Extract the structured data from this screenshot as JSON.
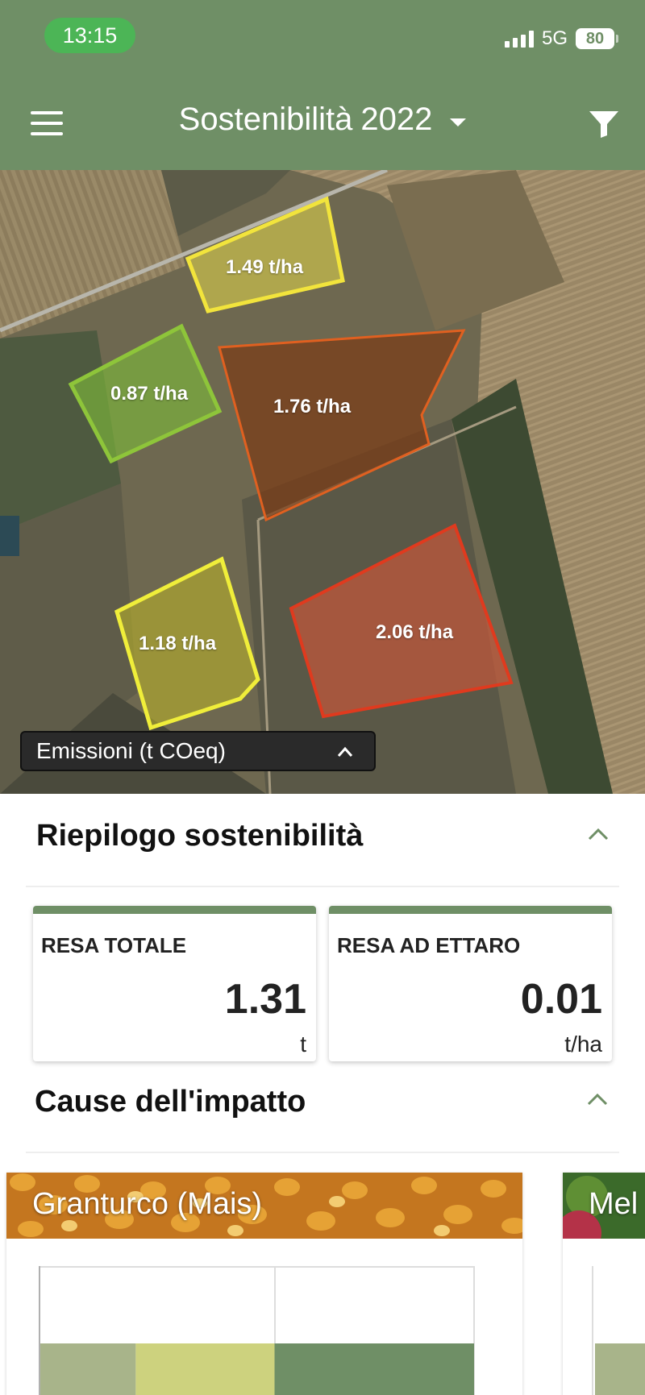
{
  "status_bar": {
    "time": "13:15",
    "network": "5G",
    "battery": "80"
  },
  "header": {
    "title": "Sostenibilità",
    "year": "2022",
    "menu_icon": "hamburger-menu-icon",
    "filter_icon": "filter-icon",
    "dropdown_icon": "caret-down-icon"
  },
  "map": {
    "fields": [
      {
        "label": "1.49 t/ha",
        "color": "#e6d94a"
      },
      {
        "label": "0.87 t/ha",
        "color": "#7cb73a"
      },
      {
        "label": "1.76 t/ha",
        "color": "#e05a1e"
      },
      {
        "label": "1.18 t/ha",
        "color": "#f0ee3a"
      },
      {
        "label": "2.06 t/ha",
        "color": "#e03a1e"
      }
    ],
    "legend_label": "Emissioni (t COeq)"
  },
  "summary": {
    "title": "Riepilogo sostenibilità",
    "cards": [
      {
        "label": "RESA TOTALE",
        "value": "1.31",
        "unit": "t"
      },
      {
        "label": "RESA AD ETTARO",
        "value": "0.01",
        "unit": "t/ha"
      }
    ]
  },
  "impact": {
    "title": "Cause dell'impatto",
    "crops": [
      {
        "name": "Granturco (Mais)",
        "bars": [
          {
            "share": 0.22,
            "color": "#a8b48a"
          },
          {
            "share": 0.32,
            "color": "#cdd27e"
          },
          {
            "share": 0.46,
            "color": "#6f8f66"
          }
        ]
      },
      {
        "name": "Mel"
      }
    ]
  },
  "colors": {
    "brand_green": "#6f8f66",
    "time_pill": "#4cb556"
  }
}
